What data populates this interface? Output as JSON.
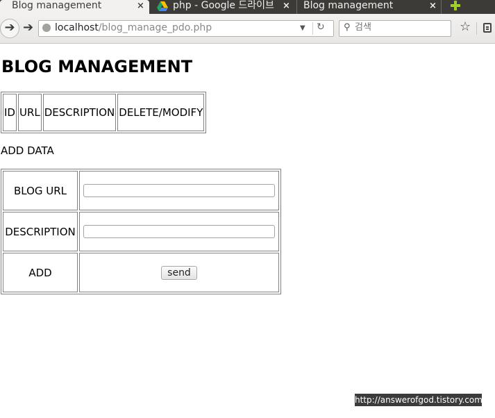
{
  "tabs": [
    {
      "label": "Blog management",
      "close": "×"
    },
    {
      "label": "php - Google 드라이브",
      "close": "×"
    },
    {
      "label": "Blog management",
      "close": "×"
    }
  ],
  "address_bar": {
    "host": "localhost",
    "path": "/blog_manage_pdo.php"
  },
  "search": {
    "placeholder": "검색"
  },
  "page": {
    "title": "BLOG MANAGEMENT",
    "list_headers": [
      "ID",
      "URL",
      "DESCRIPTION",
      "DELETE/MODIFY"
    ],
    "add_data_label": "ADD DATA",
    "form": {
      "blog_url_label": "BLOG URL",
      "description_label": "DESCRIPTION",
      "add_label": "ADD",
      "send_button": "send",
      "blog_url_value": "",
      "description_value": ""
    }
  },
  "watermark": "http://answerofgod.tistory.com",
  "colors": {
    "new_tab_plus": "#9ed12b",
    "tabbar": "#3c3b37"
  },
  "icons": [
    "back-arrow-icon",
    "forward-arrow-icon",
    "globe-icon",
    "dropdown-arrow-icon",
    "reload-icon",
    "search-icon",
    "star-icon",
    "reader-icon",
    "google-drive-icon",
    "new-tab-icon"
  ]
}
